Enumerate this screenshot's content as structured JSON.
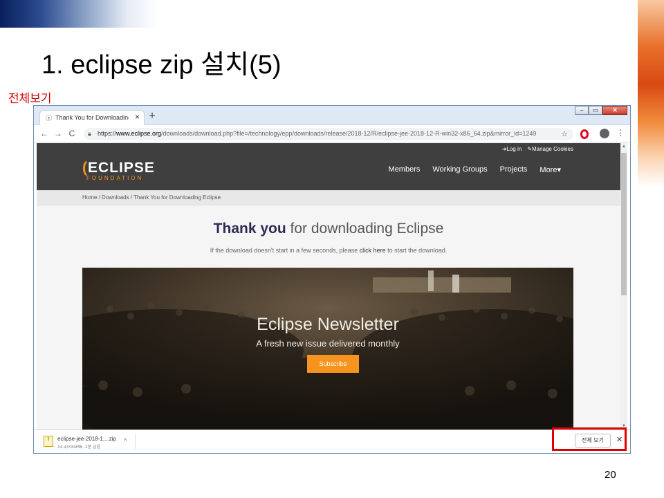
{
  "slide": {
    "title": "1. eclipse zip 설치(5)",
    "side_note": "전체보기",
    "page_number": "20"
  },
  "browser": {
    "tab_title": "Thank You for Downloading Eclipse",
    "tab_close": "×",
    "new_tab": "+",
    "window_controls": {
      "minimize": "–",
      "restore": "▭",
      "close": "✕"
    },
    "nav": {
      "back": "←",
      "forward": "→",
      "reload": "C"
    },
    "url_scheme": "https://",
    "url_host": "www.eclipse.org",
    "url_rest": "/downloads/download.php?file=/technology/epp/downloads/release/2018-12/R/eclipse-jee-2018-12-R-win32-x86_64.zip&mirror_id=1249",
    "star": "☆",
    "menu": "⋮"
  },
  "site": {
    "top_links": {
      "login": "Log in",
      "cookies": "Manage Cookies"
    },
    "logo": {
      "main": "ECLIPSE",
      "sub": "FOUNDATION"
    },
    "nav": [
      "Members",
      "Working Groups",
      "Projects",
      "More▾"
    ],
    "breadcrumb": "Home /  Downloads /  Thank You for Downloading Eclipse",
    "heading_bold": "Thank you",
    "heading_rest": " for downloading Eclipse",
    "hint_before": "If the download doesn't start in a few seconds, please ",
    "hint_link": "click here",
    "hint_after": " to start the download.",
    "banner": {
      "title": "Eclipse Newsletter",
      "subtitle": "A fresh new issue delivered monthly",
      "button": "Subscribe"
    }
  },
  "download_shelf": {
    "file_name": "eclipse-jee-2018-1....zip",
    "progress": "14.4/334MB, 2분 남음",
    "caret": "^",
    "show_all": "전체 보기",
    "close": "✕"
  },
  "colors": {
    "eclipse_orange": "#f7941e",
    "header_bg": "#3f3f3f",
    "highlight_red": "#e00000"
  }
}
